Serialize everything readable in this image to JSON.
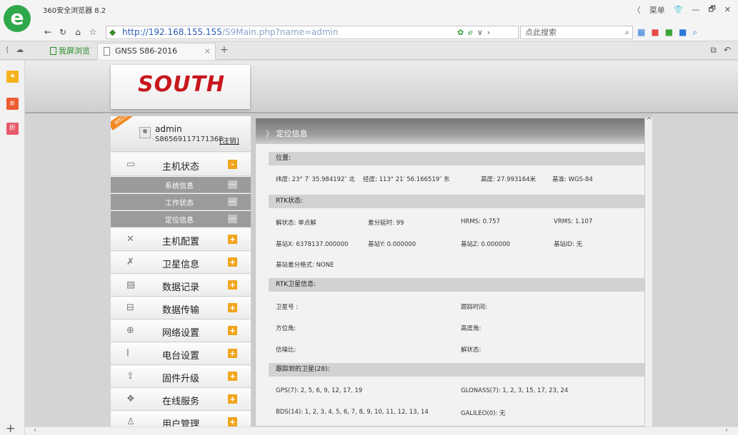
{
  "browser": {
    "title": "360安全浏览器 8.2",
    "window_controls": [
      "〈",
      "菜单",
      "👕",
      "—",
      "🗗",
      "✕"
    ],
    "url_host": "http://192.168.155.155",
    "url_path": "/S9Main.php?name=admin",
    "search_placeholder": "点此搜索",
    "tab_title": "GNSS S86-2016",
    "split_view_label": "我屏浏览",
    "new_tab": "+",
    "close_tab": "×"
  },
  "page": {
    "brand": "SOUTH",
    "welcome_ribbon": "WELCOME",
    "user": {
      "name": "admin",
      "serial": "S86569117171368",
      "logout": "[注销]"
    },
    "menu": [
      {
        "label": "主机状态",
        "toggle": "-",
        "icon": "monitor-icon"
      },
      {
        "label": "主机配置",
        "toggle": "+",
        "icon": "tools-icon"
      },
      {
        "label": "卫星信息",
        "toggle": "+",
        "icon": "satellite-icon"
      },
      {
        "label": "数据记录",
        "toggle": "+",
        "icon": "calendar-icon"
      },
      {
        "label": "数据传输",
        "toggle": "+",
        "icon": "network-icon"
      },
      {
        "label": "网络设置",
        "toggle": "+",
        "icon": "globe-icon"
      },
      {
        "label": "电台设置",
        "toggle": "+",
        "icon": "radio-icon"
      },
      {
        "label": "固件升级",
        "toggle": "+",
        "icon": "upload-icon"
      },
      {
        "label": "在线服务",
        "toggle": "+",
        "icon": "service-icon"
      },
      {
        "label": "用户管理",
        "toggle": "+",
        "icon": "user-icon"
      }
    ],
    "submenu": [
      {
        "label": "系统信息",
        "toggle": "—"
      },
      {
        "label": "工作状态",
        "toggle": "—"
      },
      {
        "label": "定位信息",
        "toggle": "—"
      }
    ],
    "panel": {
      "title": "定位信息",
      "position_header": "位置:",
      "lat": "纬度: 23° 7′ 35.984192″ 北",
      "lon": "经度: 113° 21′ 56.166519″ 东",
      "alt": "高度: 27.993164米",
      "datum": "基准: WGS-84",
      "rtk_header": "RTK状态:",
      "solution": "解状态: 单点解",
      "diff_age": "差分延时: 99",
      "hrms": "HRMS: 0.757",
      "vrms": "VRMS: 1.107",
      "base_x": "基站X: 6378137.000000",
      "base_y": "基站Y: 0.000000",
      "base_z": "基站Z: 0.000000",
      "base_id": "基站ID: 无",
      "diff_format": "基站差分格式: NONE",
      "rtk_sat_header": "RTK卫星信息:",
      "sat_no": "卫星号 :",
      "track_time": "跟踪时间:",
      "azimuth": "方位角:",
      "elevation": "高度角:",
      "snr": "信噪比:",
      "sat_solution": "解状态:",
      "tracked_header": "跟踪到的卫星(28):",
      "gps": "GPS(7): 2, 5, 6, 9, 12, 17, 19",
      "glonass": "GLONASS(7): 1, 2, 3, 15, 17, 23, 24",
      "bds": "BDS(14): 1, 2, 3, 4, 5, 6, 7, 8, 9, 10, 11, 12, 13, 14",
      "galileo": "GALILEO(0): 无"
    }
  }
}
